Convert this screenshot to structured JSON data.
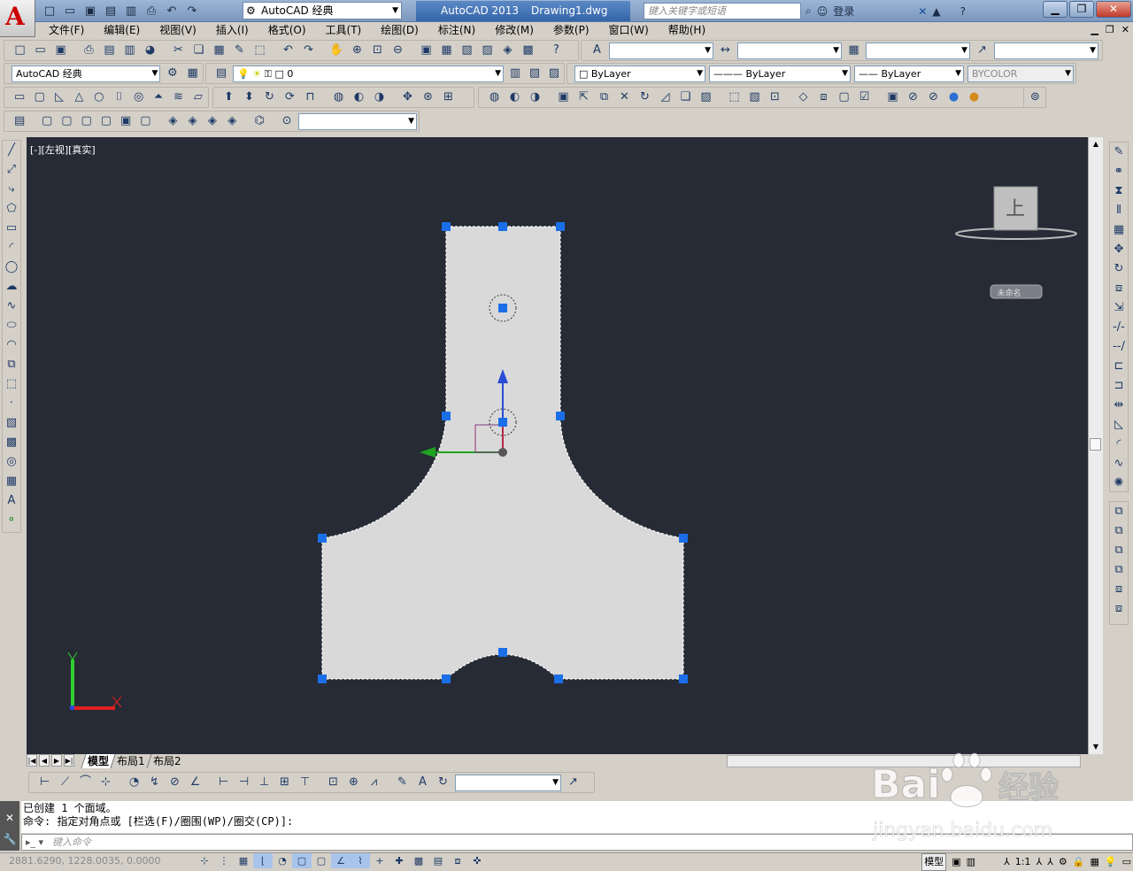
{
  "app": {
    "logo": "A",
    "workspace": "AutoCAD 经典",
    "product": "AutoCAD 2013",
    "document": "Drawing1.dwg",
    "search_placeholder": "键入关键字或短语",
    "login": "登录"
  },
  "menu": [
    "文件(F)",
    "编辑(E)",
    "视图(V)",
    "插入(I)",
    "格式(O)",
    "工具(T)",
    "绘图(D)",
    "标注(N)",
    "修改(M)",
    "参数(P)",
    "窗口(W)",
    "帮助(H)"
  ],
  "toolbars": {
    "workspace_combo": "AutoCAD 经典",
    "layer_combo": "0",
    "color_combo": "ByLayer",
    "linetype_combo": "ByLayer",
    "lineweight_combo": "ByLayer",
    "plotstyle_combo": "BYCOLOR"
  },
  "viewport": {
    "label": "[-][左视][真实]",
    "viewcube_face": "上",
    "viewcube_wcs": "未命名"
  },
  "layout_tabs": [
    "模型",
    "布局1",
    "布局2"
  ],
  "command": {
    "history": [
      "已创建 1 个面域。",
      "命令: 指定对角点或 [栏选(F)/圈围(WP)/圈交(CP)]:"
    ],
    "input_placeholder": "键入命令"
  },
  "status": {
    "coordinates": "2881.6290, 1228.0035, 0.0000",
    "model_label": "模型",
    "scale": "1:1"
  },
  "watermark": {
    "brand": "Bai",
    "brand_suffix": "经验",
    "url": "jingyan.baidu.com"
  },
  "colors": {
    "canvas_bg": "#262b35",
    "region_fill": "#d9d9d9",
    "grip": "#1a6fe8",
    "title_bg": "#3464a8"
  }
}
